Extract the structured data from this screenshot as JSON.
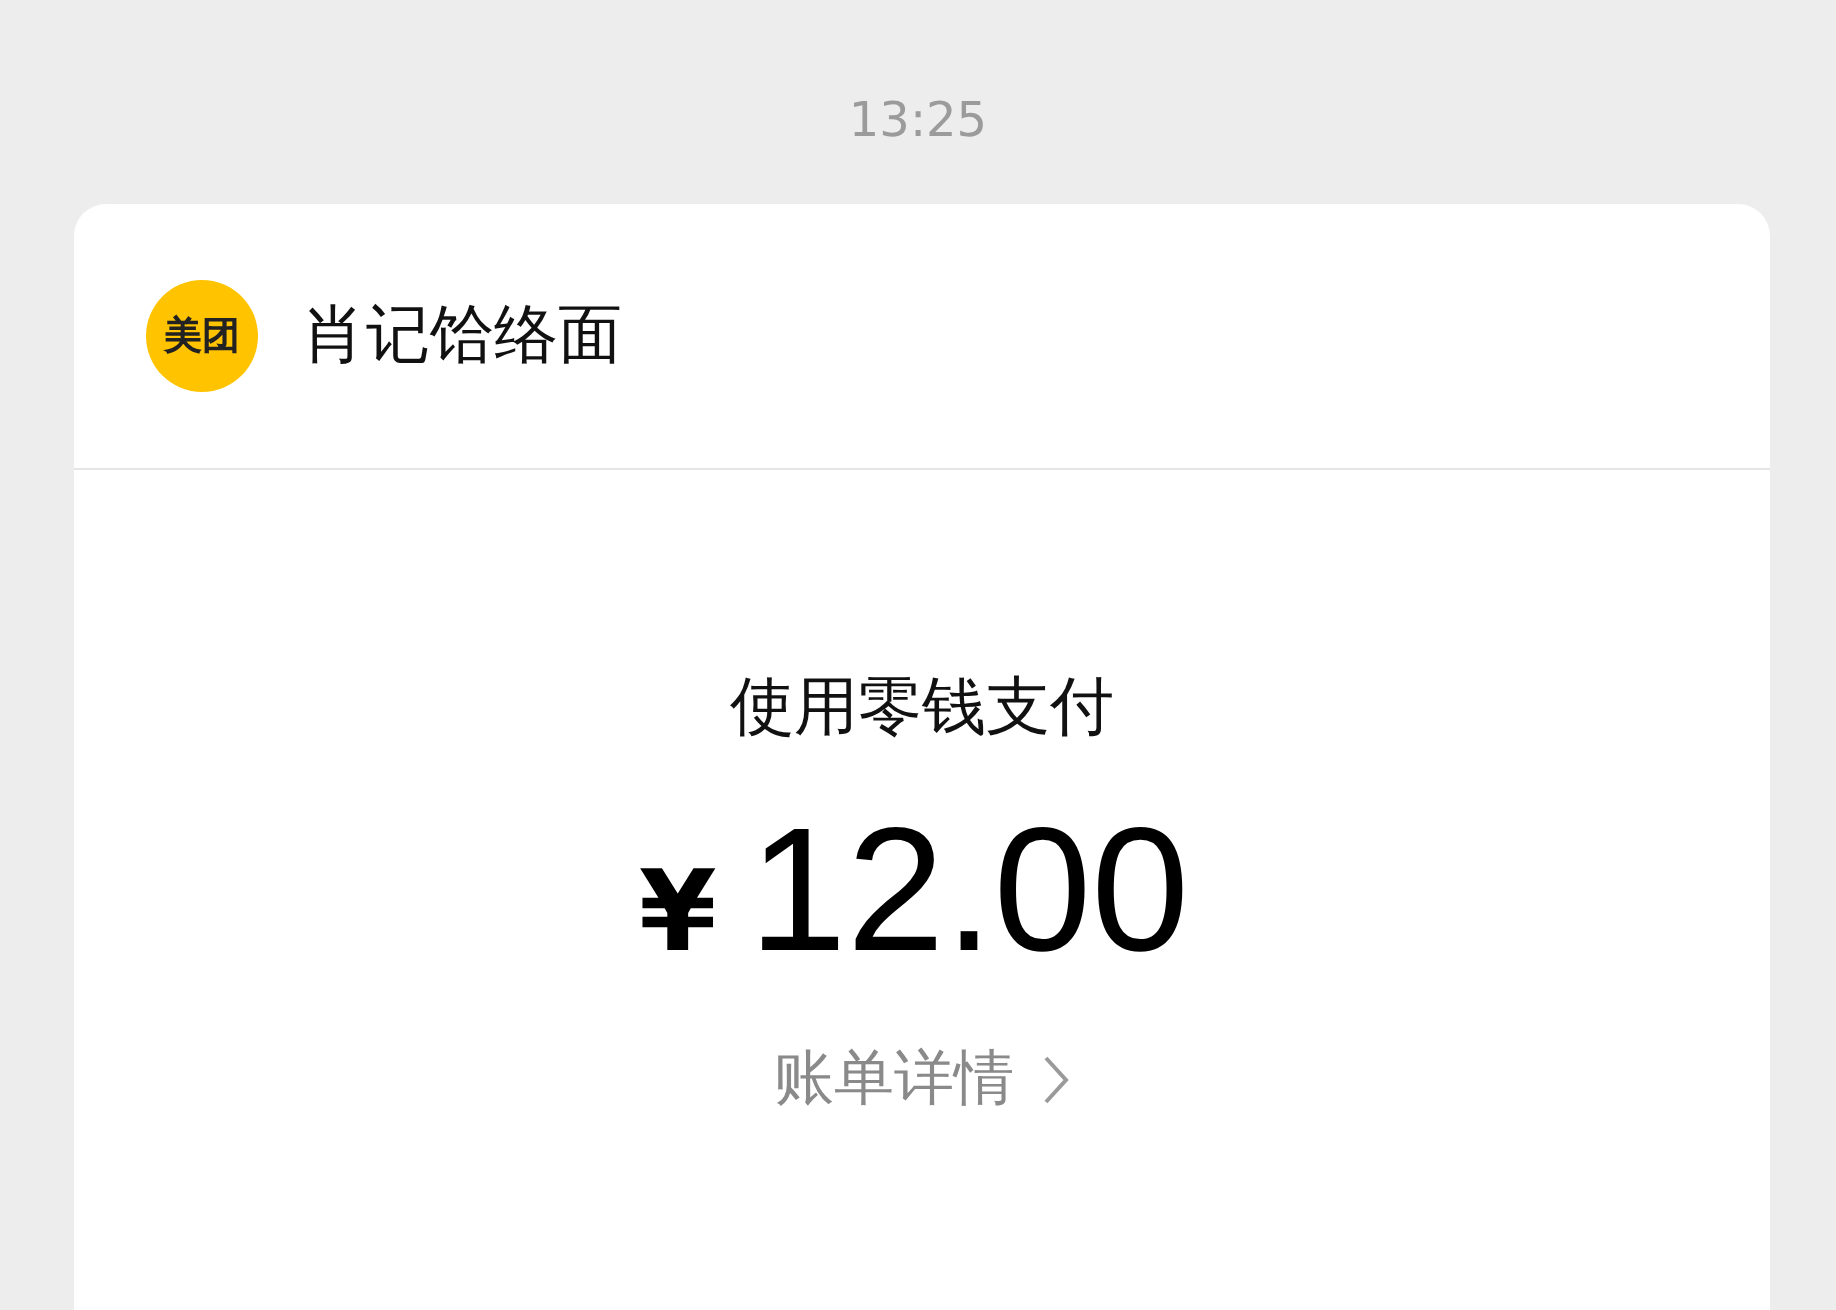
{
  "timestamp": "13:25",
  "card": {
    "merchant": {
      "logo_text": "美团",
      "name": "肖记饸络面"
    },
    "payment_method": "使用零钱支付",
    "currency": "¥",
    "amount": "12.00",
    "details_link": "账单详情"
  }
}
